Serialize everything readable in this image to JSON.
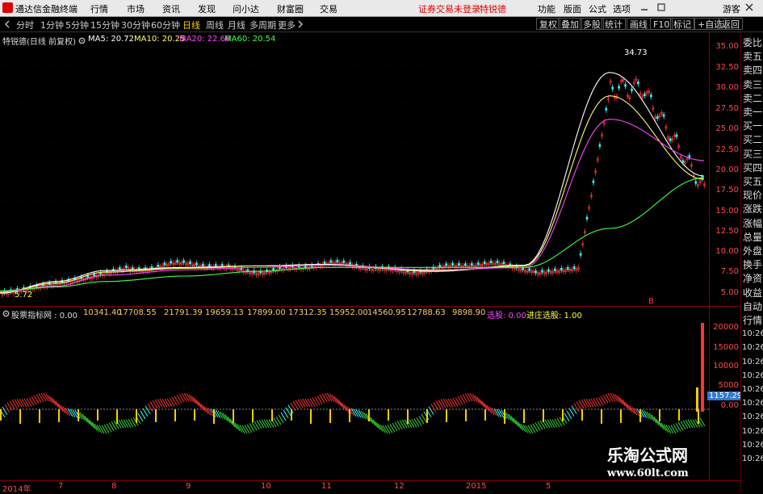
{
  "menubar": {
    "app_title": "通达信金融终端",
    "items": [
      "行情",
      "市场",
      "资讯",
      "发现",
      "问小达",
      "财富圈",
      "交易"
    ],
    "status": "证券交易未登录",
    "stock_name": "特锐德",
    "right_items": [
      "功能",
      "版面",
      "公式",
      "选项",
      "游客"
    ]
  },
  "periodbar": {
    "tabs": [
      "分时",
      "1分钟",
      "5分钟",
      "15分钟",
      "30分钟",
      "60分钟",
      "日线",
      "周线",
      "月线",
      "多周期",
      "更多"
    ],
    "active_tab": "日线",
    "right_buttons": [
      "复权",
      "叠加",
      "多股",
      "统计",
      "画线",
      "F10",
      "标记",
      "+自选",
      "返回"
    ]
  },
  "main_chart": {
    "title": "特锐德(日线 前复权)",
    "ma": [
      {
        "label": "MA5: 20.72",
        "color": "#ffffff"
      },
      {
        "label": "MA10: 20.25",
        "color": "#ffff66"
      },
      {
        "label": "MA20: 22.66",
        "color": "#ff44ff"
      },
      {
        "label": "MA60: 20.54",
        "color": "#44ff44"
      }
    ],
    "max_label": "34.73",
    "min_label": "5.72",
    "marker_b": "B",
    "y_ticks": [
      "35.00",
      "32.50",
      "30.00",
      "27.50",
      "25.00",
      "22.50",
      "20.00",
      "17.50",
      "15.00",
      "12.50",
      "10.00",
      "7.50",
      "5.00"
    ]
  },
  "sub_chart": {
    "title": "股票指标网 : 0.00",
    "values": [
      "10341.40",
      "17708.55",
      "21791.39",
      "19659.13",
      "17899.00",
      "17312.35",
      "15952.00",
      "14560.95",
      "12788.63",
      "9898.90"
    ],
    "xuangu": "选股: 0.00",
    "jinzhuang": "进庄选股: 1.00",
    "y_ticks": [
      "20000",
      "15000",
      "10000",
      "5000",
      "0.00"
    ],
    "current_value": "1157.29"
  },
  "side_panel": {
    "items": [
      "委比",
      "卖五",
      "卖四",
      "卖三",
      "卖二",
      "卖一",
      "买一",
      "买二",
      "买三",
      "买四",
      "买五",
      "现价",
      "涨跌",
      "涨幅",
      "总量",
      "外盘",
      "换手",
      "净资",
      "收益",
      "自动",
      "行情",
      "10:26",
      "10:26",
      "10:26",
      "10:26",
      "10:26",
      "10:26",
      "10:26",
      "10:26",
      "10:26",
      "10:26"
    ]
  },
  "x_axis": [
    "2014年",
    "7",
    "8",
    "9",
    "10",
    "11",
    "12",
    "2015",
    "5"
  ],
  "watermark": {
    "line1": "乐淘公式网",
    "line2": "www.60lt.com"
  },
  "chart_data": {
    "type": "line",
    "title": "特锐德(日线 前复权)",
    "ylim": [
      5,
      35
    ],
    "x": [
      "2014年",
      "7",
      "8",
      "9",
      "10",
      "11",
      "12",
      "2015",
      "5"
    ],
    "series": [
      {
        "name": "MA5",
        "values": [
          5.7,
          7.2,
          8.6,
          9.0,
          9.2,
          9.4,
          8.5,
          9.3,
          34.0,
          20.7
        ]
      },
      {
        "name": "MA10",
        "values": [
          5.8,
          7.0,
          8.4,
          8.9,
          9.2,
          9.3,
          8.6,
          9.2,
          31.0,
          20.3
        ]
      },
      {
        "name": "MA20",
        "values": [
          5.9,
          6.6,
          8.0,
          8.7,
          9.0,
          9.3,
          8.7,
          9.0,
          28.0,
          22.7
        ]
      },
      {
        "name": "MA60",
        "values": [
          6.0,
          6.5,
          7.2,
          7.9,
          8.5,
          9.0,
          9.0,
          9.0,
          14.0,
          20.5
        ]
      }
    ]
  },
  "colors": {
    "up": "#ff3333",
    "down": "#33ffff",
    "axis": "#ff4b4b",
    "grid": "#550000"
  }
}
